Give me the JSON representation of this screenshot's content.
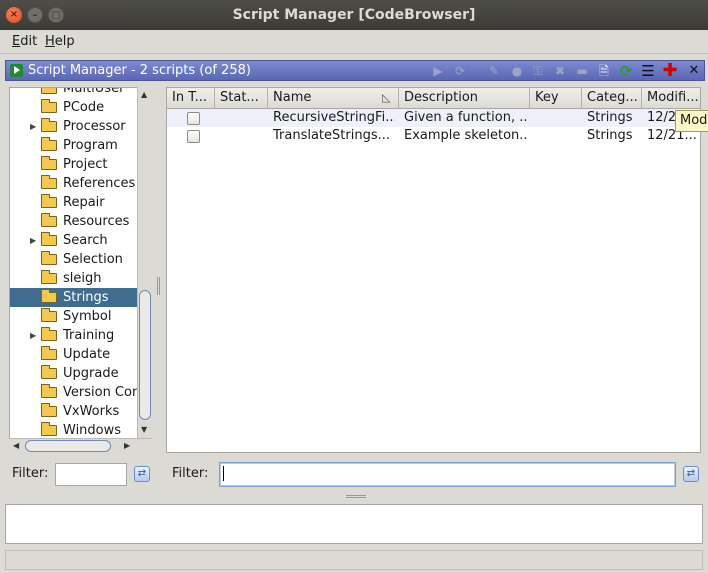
{
  "window": {
    "title": "Script Manager [CodeBrowser]",
    "controls": {
      "close": "×",
      "minimize": "–",
      "maximize": "□"
    }
  },
  "menubar": {
    "items": [
      {
        "label": "Edit",
        "mnemonic": "E",
        "rest": "dit"
      },
      {
        "label": "Help",
        "mnemonic": "H",
        "rest": "elp"
      }
    ]
  },
  "panel": {
    "title": "Script Manager - 2 scripts  (of 258)",
    "toolbar": [
      {
        "name": "run-script-icon",
        "glyph": "▶",
        "enabled": false
      },
      {
        "name": "run-last-script-icon",
        "glyph": "⟳",
        "enabled": false
      },
      {
        "name": "edit-script-icon",
        "glyph": "✎",
        "enabled": false
      },
      {
        "name": "edit-eclipse-icon",
        "glyph": "●",
        "enabled": false
      },
      {
        "name": "key-binding-icon",
        "glyph": "⚿",
        "enabled": false
      },
      {
        "name": "delete-script-icon",
        "glyph": "✖",
        "enabled": false
      },
      {
        "name": "rename-script-icon",
        "glyph": "▬",
        "enabled": false
      },
      {
        "name": "new-script-icon",
        "glyph": "🗎",
        "enabled": true
      },
      {
        "name": "refresh-icon",
        "glyph": "⟳",
        "enabled": true
      },
      {
        "name": "script-directories-icon",
        "glyph": "☰",
        "enabled": true
      },
      {
        "name": "help-icon",
        "glyph": "✚",
        "enabled": true
      },
      {
        "name": "close-panel-icon",
        "glyph": "✕",
        "enabled": true
      }
    ]
  },
  "tree": {
    "items": [
      {
        "label": "MultiUser",
        "expandable": false,
        "selected": false
      },
      {
        "label": "PCode",
        "expandable": false,
        "selected": false
      },
      {
        "label": "Processor",
        "expandable": true,
        "selected": false
      },
      {
        "label": "Program",
        "expandable": false,
        "selected": false
      },
      {
        "label": "Project",
        "expandable": false,
        "selected": false
      },
      {
        "label": "References",
        "expandable": false,
        "selected": false
      },
      {
        "label": "Repair",
        "expandable": false,
        "selected": false
      },
      {
        "label": "Resources",
        "expandable": false,
        "selected": false
      },
      {
        "label": "Search",
        "expandable": true,
        "selected": false
      },
      {
        "label": "Selection",
        "expandable": false,
        "selected": false
      },
      {
        "label": "sleigh",
        "expandable": false,
        "selected": false
      },
      {
        "label": "Strings",
        "expandable": false,
        "selected": true
      },
      {
        "label": "Symbol",
        "expandable": false,
        "selected": false
      },
      {
        "label": "Training",
        "expandable": true,
        "selected": false
      },
      {
        "label": "Update",
        "expandable": false,
        "selected": false
      },
      {
        "label": "Upgrade",
        "expandable": false,
        "selected": false
      },
      {
        "label": "Version Con",
        "expandable": false,
        "selected": false
      },
      {
        "label": "VxWorks",
        "expandable": false,
        "selected": false
      },
      {
        "label": "Windows",
        "expandable": false,
        "selected": false
      }
    ],
    "filter_label": "Filter:",
    "filter_value": ""
  },
  "table": {
    "columns": [
      "In T...",
      "Stat...",
      "Name",
      "Description",
      "Key",
      "Categ...",
      "Modifi..."
    ],
    "rows": [
      {
        "in_tool": false,
        "status": "",
        "name": "RecursiveStringFi...",
        "description": "Given a function, ...",
        "key": "",
        "category": "Strings",
        "modified": "12/2"
      },
      {
        "in_tool": false,
        "status": "",
        "name": "TranslateStrings...",
        "description": "Example skeleton...",
        "key": "",
        "category": "Strings",
        "modified": "12/21..."
      }
    ],
    "tooltip": "Modi",
    "filter_label": "Filter:",
    "filter_value": ""
  },
  "colors": {
    "panel_header": "#6a77c2",
    "selection": "#3f6c8f",
    "alt_row": "#eef1fa",
    "tooltip_bg": "#fbf7c7"
  }
}
